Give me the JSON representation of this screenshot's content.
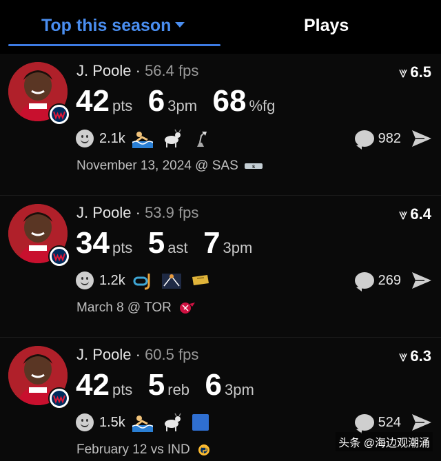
{
  "tabs": {
    "top": "Top this season",
    "plays": "Plays"
  },
  "colors": {
    "accent": "#3d7be3",
    "team_red": "#b0202a"
  },
  "cards": [
    {
      "player": "J. Poole",
      "fps": "56.4 fps",
      "rating": "6.5",
      "stats": [
        {
          "num": "42",
          "unit": "pts"
        },
        {
          "num": "6",
          "unit": "3pm"
        },
        {
          "num": "68",
          "unit": "%fg"
        }
      ],
      "reactions": "2.1k",
      "emojis": [
        "swimmer-icon",
        "goat-icon",
        "lamp-icon"
      ],
      "comments": "982",
      "date": "November 13, 2024 @ SAS",
      "opponent_icon": "spurs-logo-icon"
    },
    {
      "player": "J. Poole",
      "fps": "53.9 fps",
      "rating": "6.4",
      "stats": [
        {
          "num": "34",
          "unit": "pts"
        },
        {
          "num": "5",
          "unit": "ast"
        },
        {
          "num": "7",
          "unit": "3pm"
        }
      ],
      "reactions": "1.2k",
      "emojis": [
        "snorkel-icon",
        "basketball-court-icon",
        "ticket-icon"
      ],
      "comments": "269",
      "date": "March 8 @ TOR",
      "opponent_icon": "raptors-logo-icon"
    },
    {
      "player": "J. Poole",
      "fps": "60.5 fps",
      "rating": "6.3",
      "stats": [
        {
          "num": "42",
          "unit": "pts"
        },
        {
          "num": "5",
          "unit": "reb"
        },
        {
          "num": "6",
          "unit": "3pm"
        }
      ],
      "reactions": "1.5k",
      "emojis": [
        "swimmer-icon",
        "goat-icon",
        "blue-square-icon"
      ],
      "comments": "524",
      "date": "February 12 vs IND",
      "opponent_icon": "pacers-logo-icon"
    }
  ],
  "watermark": "头条 @海边观潮涌"
}
